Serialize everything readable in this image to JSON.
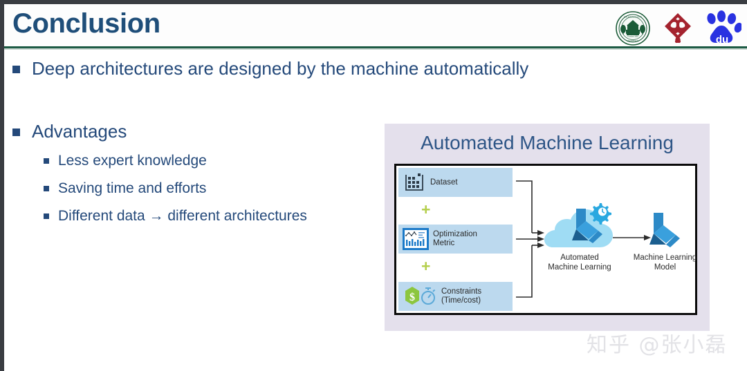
{
  "slide": {
    "title": "Conclusion",
    "accent_blue": "#24497a",
    "rule_green": "#1d5b44",
    "panel_bg": "#e4e0ec"
  },
  "logos": [
    {
      "name": "michigan-state-university-seal",
      "alt": "Michigan State University seal",
      "color": "#1b5c38"
    },
    {
      "name": "hong-kong-polytechnic-university-logo",
      "alt": "PolyU knot logo",
      "color": "#a4232e"
    },
    {
      "name": "baidu-logo",
      "alt": "Baidu paw logo",
      "color": "#2932e1"
    }
  ],
  "bullets": [
    {
      "level": 1,
      "text": "Deep architectures are designed by the machine automatically"
    },
    {
      "level": 1,
      "text": "Advantages"
    },
    {
      "level": 2,
      "text": "Less expert knowledge"
    },
    {
      "level": 2,
      "text": "Saving time and efforts"
    },
    {
      "level": 2,
      "text": "Different data → different architectures"
    }
  ],
  "figure": {
    "title": "Automated Machine Learning",
    "inputs": [
      {
        "label": "Dataset",
        "label2": "",
        "icon": "dataset-grid-icon"
      },
      {
        "label": "Optimization",
        "label2": "Metric",
        "icon": "bar-chart-icon"
      },
      {
        "label": "Constraints",
        "label2": "(Time/cost)",
        "icon": "dollar-stopwatch-icon"
      }
    ],
    "connectors": [
      "+",
      "+"
    ],
    "process": {
      "line1": "Automated",
      "line2": "Machine Learning",
      "icon": "cloud-ml-gear-icon"
    },
    "output": {
      "line1": "Machine Learning",
      "line2": "Model",
      "icon": "ml-model-icon"
    }
  },
  "watermark": {
    "text": "知乎 @张小磊"
  }
}
